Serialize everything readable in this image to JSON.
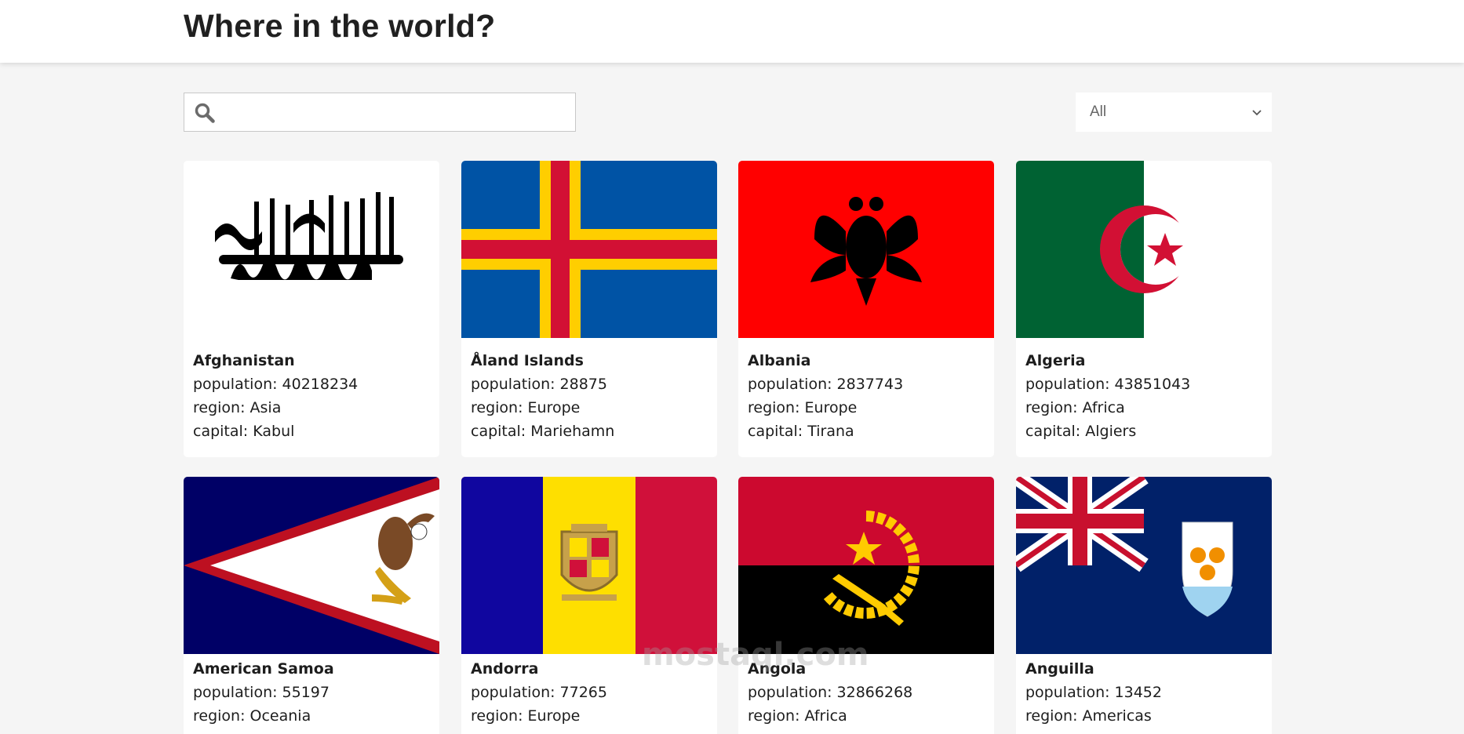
{
  "header": {
    "title": "Where in the world?"
  },
  "search": {
    "value": "",
    "placeholder": ""
  },
  "filter": {
    "selected": "All"
  },
  "labels": {
    "population": "population: ",
    "region": "region: ",
    "capital": "capital: "
  },
  "countries": [
    {
      "name": "Afghanistan",
      "population": "40218234",
      "region": "Asia",
      "capital": "Kabul",
      "flag_icon": "afghanistan-flag-icon"
    },
    {
      "name": "Åland Islands",
      "population": "28875",
      "region": "Europe",
      "capital": "Mariehamn",
      "flag_icon": "aland-islands-flag-icon"
    },
    {
      "name": "Albania",
      "population": "2837743",
      "region": "Europe",
      "capital": "Tirana",
      "flag_icon": "albania-flag-icon"
    },
    {
      "name": "Algeria",
      "population": "43851043",
      "region": "Africa",
      "capital": "Algiers",
      "flag_icon": "algeria-flag-icon"
    },
    {
      "name": "American Samoa",
      "population": "55197",
      "region": "Oceania",
      "capital": "",
      "flag_icon": "american-samoa-flag-icon"
    },
    {
      "name": "Andorra",
      "population": "77265",
      "region": "Europe",
      "capital": "",
      "flag_icon": "andorra-flag-icon"
    },
    {
      "name": "Angola",
      "population": "32866268",
      "region": "Africa",
      "capital": "",
      "flag_icon": "angola-flag-icon"
    },
    {
      "name": "Anguilla",
      "population": "13452",
      "region": "Americas",
      "capital": "",
      "flag_icon": "anguilla-flag-icon"
    }
  ],
  "watermark": {
    "text": "mostaql.com"
  },
  "colors": {
    "background": "#f5f5f5",
    "card": "#ffffff",
    "header": "#ffffff"
  }
}
